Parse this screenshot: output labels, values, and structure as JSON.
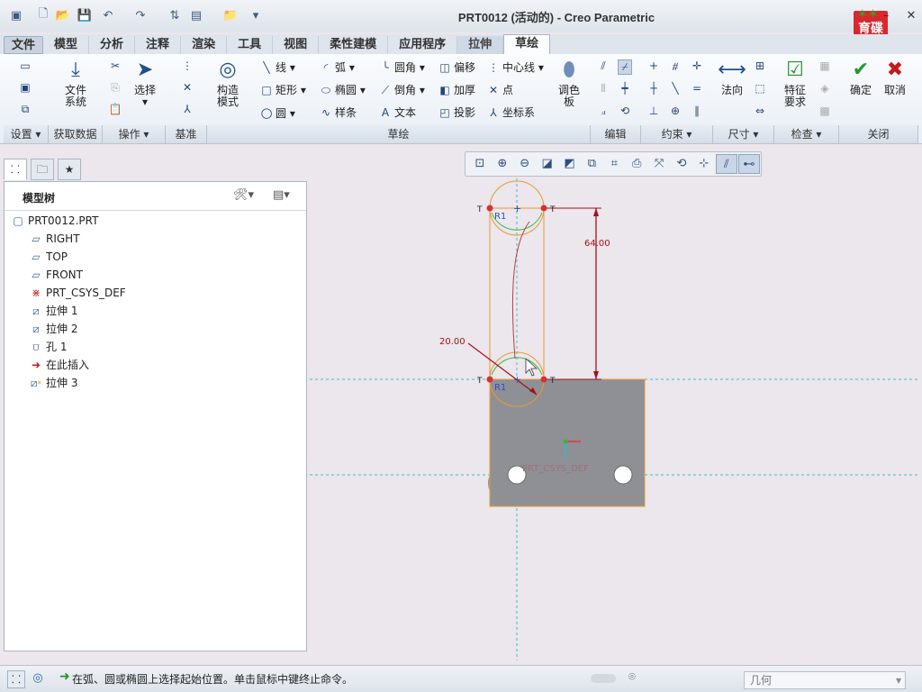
{
  "window": {
    "title": "PRT0012 (活动的) - Creo Parametric",
    "logo_text": "育碟软件",
    "minimize": "–",
    "maximize": "□",
    "close": "✕"
  },
  "quick_access": [
    "new-file-icon",
    "open-icon",
    "save-icon",
    "undo-icon",
    "redo-icon",
    "regenerate-icon",
    "windows-icon",
    "close-window-icon",
    "customize-icon"
  ],
  "tabs": [
    {
      "label": "文件"
    },
    {
      "label": "模型"
    },
    {
      "label": "分析"
    },
    {
      "label": "注释"
    },
    {
      "label": "渲染"
    },
    {
      "label": "工具"
    },
    {
      "label": "视图"
    },
    {
      "label": "柔性建模"
    },
    {
      "label": "应用程序"
    },
    {
      "label": "拉伸"
    },
    {
      "label": "草绘"
    }
  ],
  "ribbon": {
    "get_data": "文件\n系统",
    "file_system_1": "文件",
    "file_system_2": "系统",
    "select": "选择",
    "construction_1": "构造",
    "construction_2": "模式",
    "line": "线",
    "rectangle": "矩形",
    "circle": "圆",
    "arc": "弧",
    "ellipse": "椭圆",
    "spline": "样条",
    "fillet": "圆角",
    "chamfer": "倒角",
    "text": "文本",
    "offset": "偏移",
    "thicken": "加厚",
    "project": "投影",
    "centerline": "中心线",
    "point": "点",
    "coordinate_system": "坐标系",
    "palette_1": "调色",
    "palette_2": "板",
    "normal": "法向",
    "feature_req_1": "特征",
    "feature_req_2": "要求",
    "ok": "确定",
    "cancel": "取消",
    "groups": {
      "setup": "设置 ▾",
      "get_data": "获取数据",
      "operations": "操作 ▾",
      "datum": "基准",
      "sketch": "草绘",
      "edit": "编辑",
      "constrain": "约束 ▾",
      "dimension": "尺寸 ▾",
      "inspect": "检查 ▾",
      "close": "关闭"
    }
  },
  "model_tree": {
    "title": "模型树",
    "items": [
      {
        "label": "PRT0012.PRT",
        "icon": "part-icon"
      },
      {
        "label": "RIGHT",
        "icon": "datum-plane-icon"
      },
      {
        "label": "TOP",
        "icon": "datum-plane-icon"
      },
      {
        "label": "FRONT",
        "icon": "datum-plane-icon"
      },
      {
        "label": "PRT_CSYS_DEF",
        "icon": "csys-icon"
      },
      {
        "label": "拉伸 1",
        "icon": "extrude-icon"
      },
      {
        "label": "拉伸 2",
        "icon": "extrude-icon"
      },
      {
        "label": "孔 1",
        "icon": "hole-icon"
      },
      {
        "label": "在此插入",
        "icon": "insert-here-icon"
      },
      {
        "label": "拉伸 3",
        "icon": "extrude-new-icon"
      }
    ]
  },
  "sketch": {
    "dim_vertical": "64.00",
    "dim_diameter": "20.00",
    "csys_label": "PRT_CSYS_DEF",
    "radius_label_top": "R1",
    "radius_label_bottom": "R1",
    "tangent_marker": "T",
    "colors": {
      "sketch_orange": "#e89a2d",
      "dimension_red": "#a01218",
      "datum_cyan": "#3ac3c3",
      "model_gray": "#8e9096",
      "constraint_blue": "#2a4fc0"
    }
  },
  "status": {
    "message": "在弧、圆或椭圆上选择起始位置。单击鼠标中键终止命令。",
    "filter": "几何"
  }
}
